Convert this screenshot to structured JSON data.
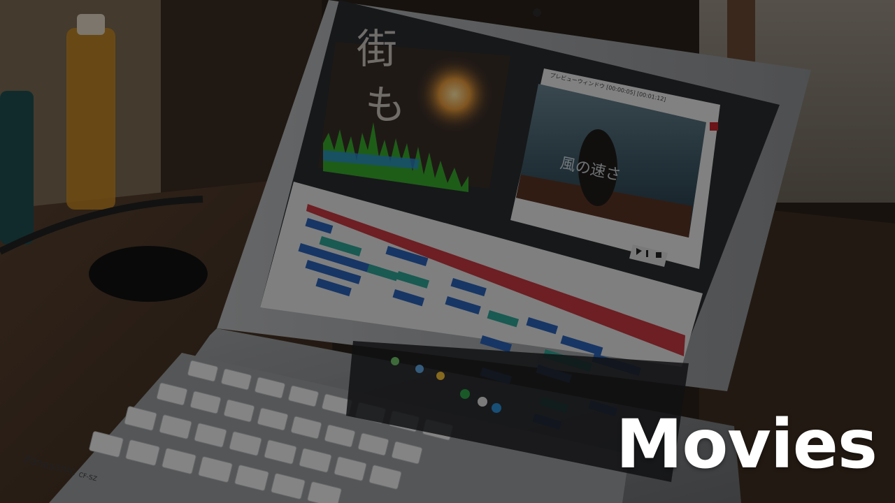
{
  "headline": "Movies",
  "photo": {
    "subject": "Panasonic laptop showing a video editing application with a preview window",
    "colors": {
      "wall": "#8c8478",
      "desk": "#4a3626",
      "laptop_body": "#8d8f92",
      "screen": "#2a2d31",
      "overlay": "rgba(0,0,0,0.45)",
      "track_red": "#c3262e",
      "clip_blue": "#2a63b8",
      "clip_teal": "#2fa596",
      "waveform": "#39b82e"
    }
  },
  "laptop": {
    "brand": "Panasonic",
    "model": "CF-SZ"
  },
  "screen_text": {
    "title_glyphs": [
      "街",
      "も"
    ],
    "preview_window_title": "プレビューウィンドウ [00:00:05] [00:01:12]",
    "preview_caption": "風の速さ"
  },
  "icons": [
    "keyboard-icon",
    "waveform-icon",
    "taskbar-icons",
    "play-icon",
    "pause-icon",
    "stop-icon"
  ]
}
